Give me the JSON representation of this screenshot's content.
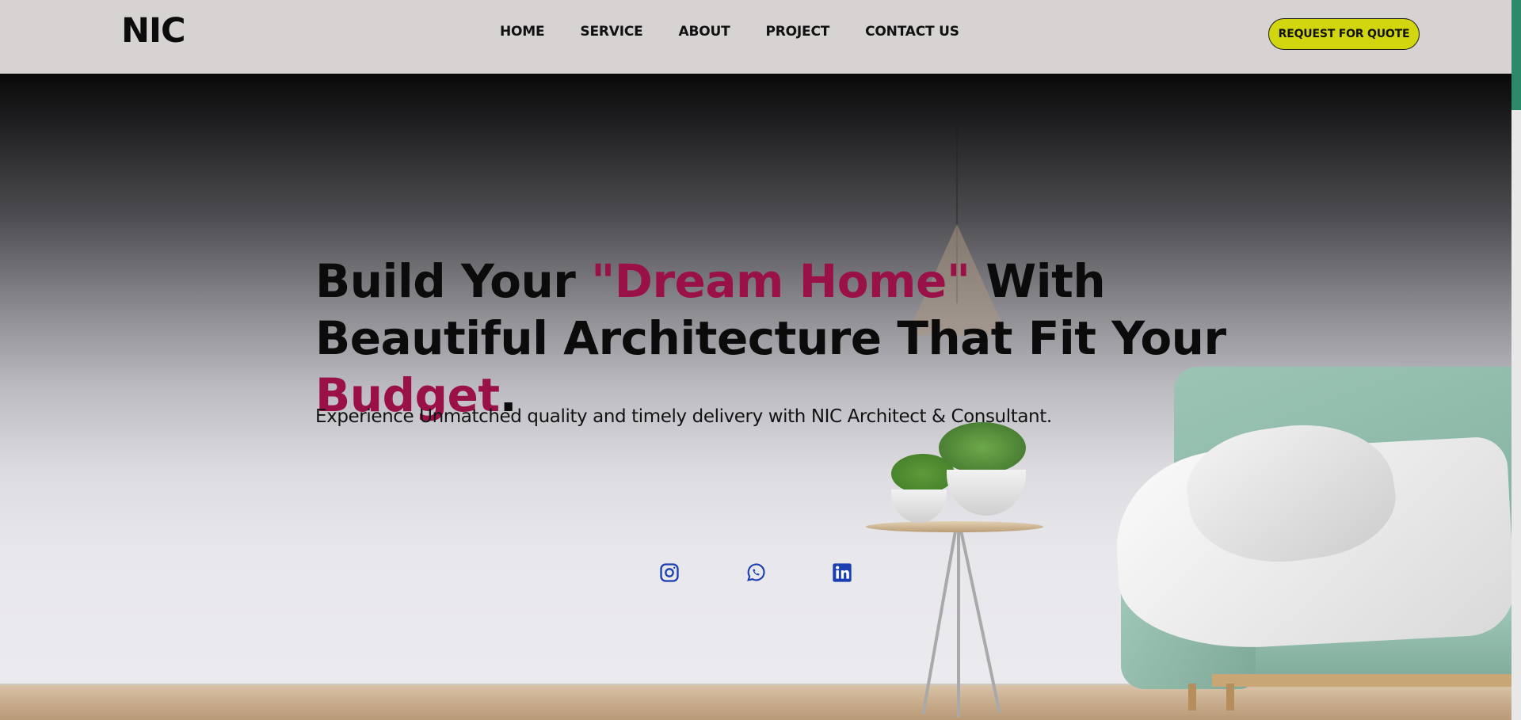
{
  "brand": {
    "logo_text": "NIC"
  },
  "nav": {
    "items": [
      {
        "label": "HOME"
      },
      {
        "label": "SERVICE"
      },
      {
        "label": "ABOUT"
      },
      {
        "label": "PROJECT"
      },
      {
        "label": "CONTACT US"
      }
    ]
  },
  "header": {
    "cta_label": "REQUEST FOR QUOTE"
  },
  "hero": {
    "headline": {
      "part1": "Build Your ",
      "accent1": "\"Dream Home\"",
      "part2": " With Beautiful Architecture That Fit Your ",
      "accent2": "Budget",
      "part3": "."
    },
    "subline": "Experience Unmatched quality and timely delivery with NIC Architect & Consultant."
  },
  "social": [
    {
      "icon": "instagram-icon"
    },
    {
      "icon": "whatsapp-icon"
    },
    {
      "icon": "linkedin-icon"
    }
  ],
  "colors": {
    "accent": "#9a1148",
    "cta_background": "#d2d60f",
    "social_icon": "#1a3fb0",
    "header_background": "#d6d3d2",
    "scroll_thumb": "#2c8a6b"
  }
}
